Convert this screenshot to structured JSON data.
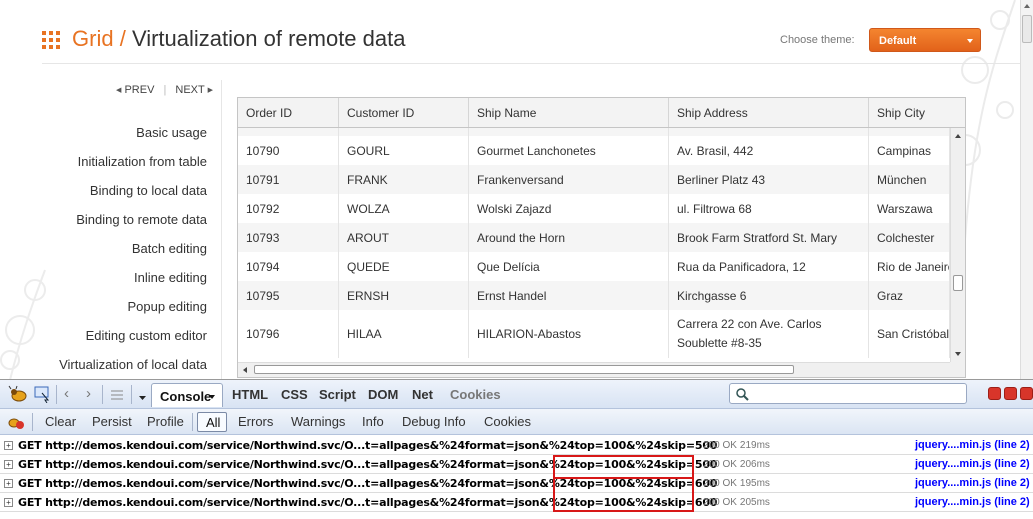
{
  "header": {
    "category": "Grid",
    "separator": "/",
    "title": "Virtualization of remote data",
    "theme_label": "Choose theme:",
    "theme_value": "Default"
  },
  "pager": {
    "prev": "PREV",
    "next": "NEXT"
  },
  "nav": {
    "items": [
      "Basic usage",
      "Initialization from table",
      "Binding to local data",
      "Binding to remote data",
      "Batch editing",
      "Inline editing",
      "Popup editing",
      "Editing custom editor",
      "Virtualization of local data"
    ]
  },
  "grid": {
    "columns": [
      "Order ID",
      "Customer ID",
      "Ship Name",
      "Ship Address",
      "Ship City"
    ],
    "rows": [
      [
        "10790",
        "GOURL",
        "Gourmet Lanchonetes",
        "Av. Brasil, 442",
        "Campinas"
      ],
      [
        "10791",
        "FRANK",
        "Frankenversand",
        "Berliner Platz 43",
        "München"
      ],
      [
        "10792",
        "WOLZA",
        "Wolski Zajazd",
        "ul. Filtrowa 68",
        "Warszawa"
      ],
      [
        "10793",
        "AROUT",
        "Around the Horn",
        "Brook Farm Stratford St. Mary",
        "Colchester"
      ],
      [
        "10794",
        "QUEDE",
        "Que Delícia",
        "Rua da Panificadora, 12",
        "Rio de Janeiro"
      ],
      [
        "10795",
        "ERNSH",
        "Ernst Handel",
        "Kirchgasse 6",
        "Graz"
      ],
      [
        "10796",
        "HILAA",
        "HILARION-Abastos",
        "Carrera 22 con Ave. Carlos Soublette #8-35",
        "San Cristóbal"
      ]
    ]
  },
  "firebug": {
    "tabs": [
      "Console",
      "HTML",
      "CSS",
      "Script",
      "DOM",
      "Net",
      "Cookies"
    ],
    "filters": [
      "Clear",
      "Persist",
      "Profile",
      "All",
      "Errors",
      "Warnings",
      "Info",
      "Debug Info",
      "Cookies"
    ],
    "log": [
      {
        "url": "GET http://demos.kendoui.com/service/Northwind.svc/O...t=allpages&%24format=json&%24top=100&%24skip=500",
        "status": "200 OK",
        "time": "219ms",
        "source": "jquery....min.js (line 2)"
      },
      {
        "url": "GET http://demos.kendoui.com/service/Northwind.svc/O...t=allpages&%24format=json&%24top=100&%24skip=500",
        "status": "200 OK",
        "time": "206ms",
        "source": "jquery....min.js (line 2)"
      },
      {
        "url": "GET http://demos.kendoui.com/service/Northwind.svc/O...t=allpages&%24format=json&%24top=100&%24skip=600",
        "status": "200 OK",
        "time": "195ms",
        "source": "jquery....min.js (line 2)"
      },
      {
        "url": "GET http://demos.kendoui.com/service/Northwind.svc/O...t=allpages&%24format=json&%24top=100&%24skip=600",
        "status": "200 OK",
        "time": "205ms",
        "source": "jquery....min.js (line 2)"
      }
    ]
  },
  "colors": {
    "accent": "#e87322",
    "highlight": "#d81818",
    "link": "#0000ff"
  },
  "icons": [
    "grid-icon",
    "firebug-icon",
    "inspect-icon",
    "back-icon",
    "forward-icon",
    "list-icon",
    "search-icon",
    "error-filter-icon"
  ]
}
